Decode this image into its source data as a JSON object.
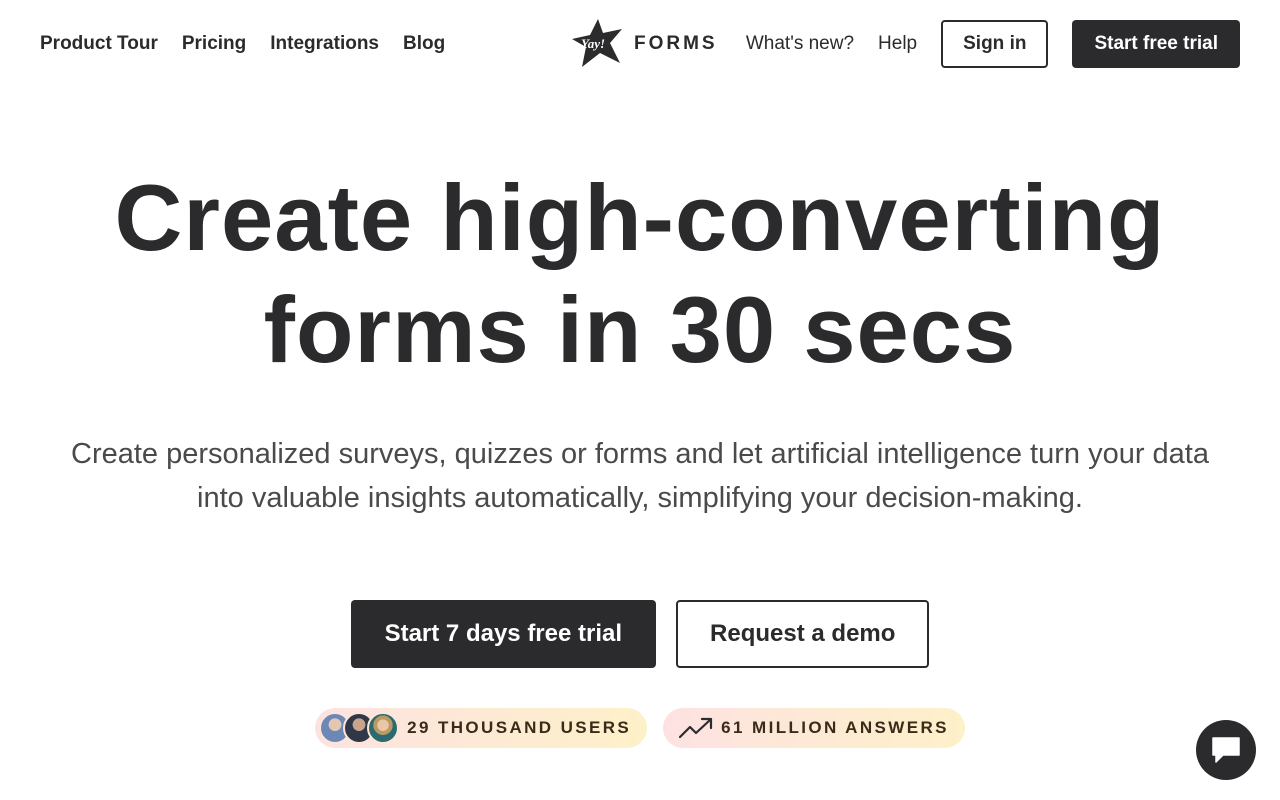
{
  "header": {
    "nav_left": [
      "Product Tour",
      "Pricing",
      "Integrations",
      "Blog"
    ],
    "logo": {
      "mark_text": "Yay!",
      "text": "FORMS"
    },
    "whats_new": "What's new?",
    "help": "Help",
    "sign_in": "Sign in",
    "start_trial": "Start free trial"
  },
  "hero": {
    "title_line1": "Create high-converting",
    "title_line2": "forms in 30 secs",
    "subtitle_line1": "Create personalized surveys, quizzes or forms and let artificial intelligence turn your data",
    "subtitle_line2": "into valuable insights automatically, simplifying your decision-making.",
    "cta_primary": "Start 7 days free trial",
    "cta_secondary": "Request a demo"
  },
  "badges": {
    "users": "29 THOUSAND USERS",
    "answers": "61 MILLION ANSWERS"
  },
  "colors": {
    "text_dark": "#2b2b2d",
    "badge_gradient_start": "#fde2e2",
    "badge_gradient_end": "#fdf1c8"
  },
  "icons": {
    "logo": "yay-star-logo-icon",
    "trend": "trending-up-icon",
    "chat": "chat-bubble-icon"
  }
}
